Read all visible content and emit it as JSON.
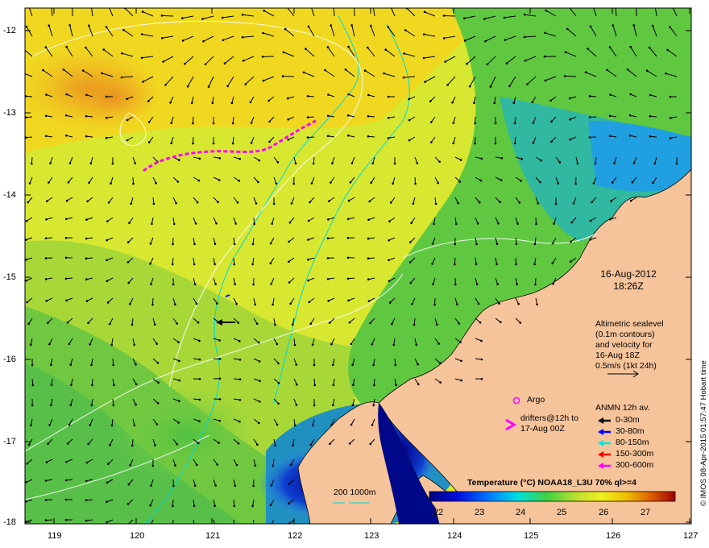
{
  "map": {
    "date_label": "16-Aug-2012",
    "time_label": "18:26Z",
    "altimetry_note": [
      "Altimetric sealevel",
      "(0.1m contours)",
      "and velocity for",
      "16-Aug 18Z",
      "0.5m/s (1kt 24h)"
    ],
    "argo_label": "Argo",
    "drifters_label": [
      "drifters@12h to",
      "17-Aug 00Z"
    ],
    "anmn_title": "ANMN 12h av.",
    "anmn_items": [
      {
        "label": "0-30m",
        "color": "#000000"
      },
      {
        "label": "30-80m",
        "color": "#0000ff"
      },
      {
        "label": "80-150m",
        "color": "#00e5e5"
      },
      {
        "label": "150-300m",
        "color": "#ff0000"
      },
      {
        "label": "300-600m",
        "color": "#ff00ff"
      }
    ],
    "isobath_label": "200  1000m",
    "colorbar_title": "Temperature (°C) NOAA18_L3U 70% ql>=4",
    "colorbar_ticks": [
      "22",
      "23",
      "24",
      "25",
      "26",
      "27"
    ],
    "credit": "© IMOS 08-Apr-2015 01:57:47 Hobart time",
    "lon_ticks": [
      "119",
      "120",
      "121",
      "122",
      "123",
      "124",
      "125",
      "126",
      "127"
    ],
    "lat_ticks": [
      "-12",
      "-13",
      "-14",
      "-15",
      "-16",
      "-17",
      "-18"
    ],
    "colors": {
      "land": "#f6c49a",
      "isobath": "#00d8d8",
      "drifter": "#ff00ff",
      "warm": "#f0a000",
      "cool": "#2040c0"
    }
  }
}
